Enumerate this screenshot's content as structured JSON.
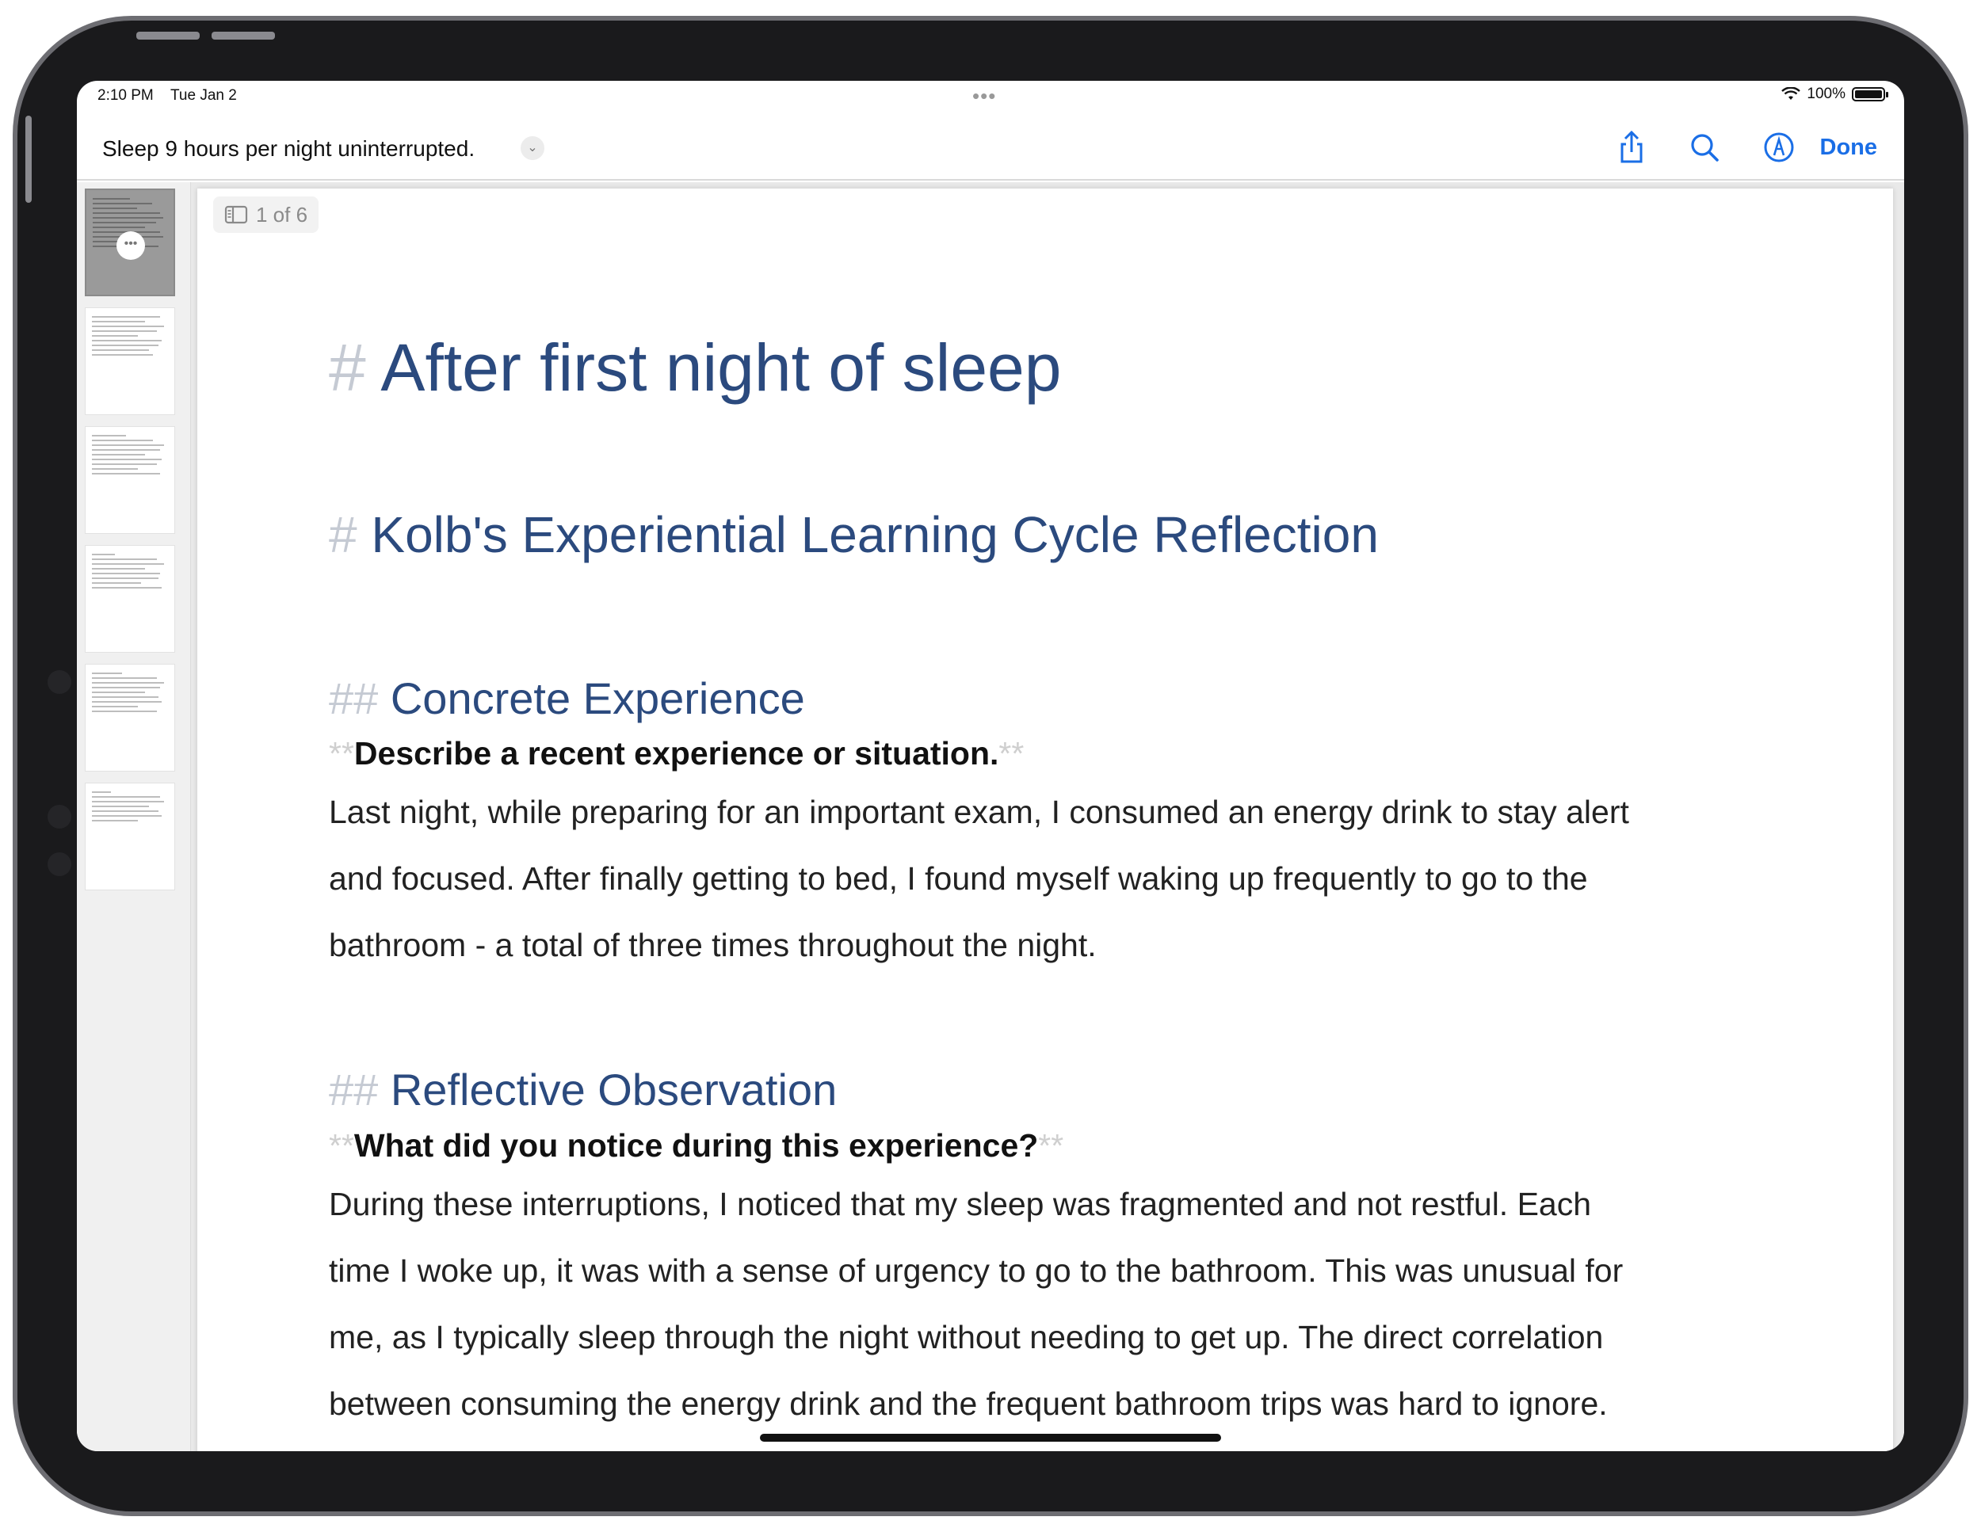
{
  "status_bar": {
    "time": "2:10 PM",
    "date": "Tue Jan 2",
    "battery": "100%"
  },
  "nav": {
    "title": "Sleep 9 hours per night uninterrupted.",
    "done_label": "Done",
    "icons": [
      "share-icon",
      "search-icon",
      "markup-icon"
    ],
    "accent_color": "#1a6ee6"
  },
  "page_indicator": "1 of 6",
  "document": {
    "h1_marker": "#",
    "h1": "After first night of sleep",
    "h1b": "Kolb's Experiential Learning Cycle Reflection",
    "h2_marker": "##",
    "bold_marker": "**",
    "sections": [
      {
        "heading": "Concrete Experience",
        "question": "Describe a recent experience or situation.",
        "lines": [
          "Last night, while preparing for an important exam, I consumed an energy drink to stay alert",
          "and focused. After finally getting to bed, I found myself waking up frequently to go to the",
          "bathroom - a total of three times throughout the night."
        ]
      },
      {
        "heading": "Reflective Observation",
        "question": "What did you notice during this experience?",
        "lines": [
          "During these interruptions, I noticed that my sleep was fragmented and not restful. Each",
          "time I woke up, it was with a sense of urgency to go to the bathroom. This was unusual for",
          "me, as I typically sleep through the night without needing to get up. The direct correlation",
          "between consuming the energy drink and the frequent bathroom trips was hard to ignore."
        ]
      }
    ],
    "heading_color": "#2b4a7e"
  }
}
